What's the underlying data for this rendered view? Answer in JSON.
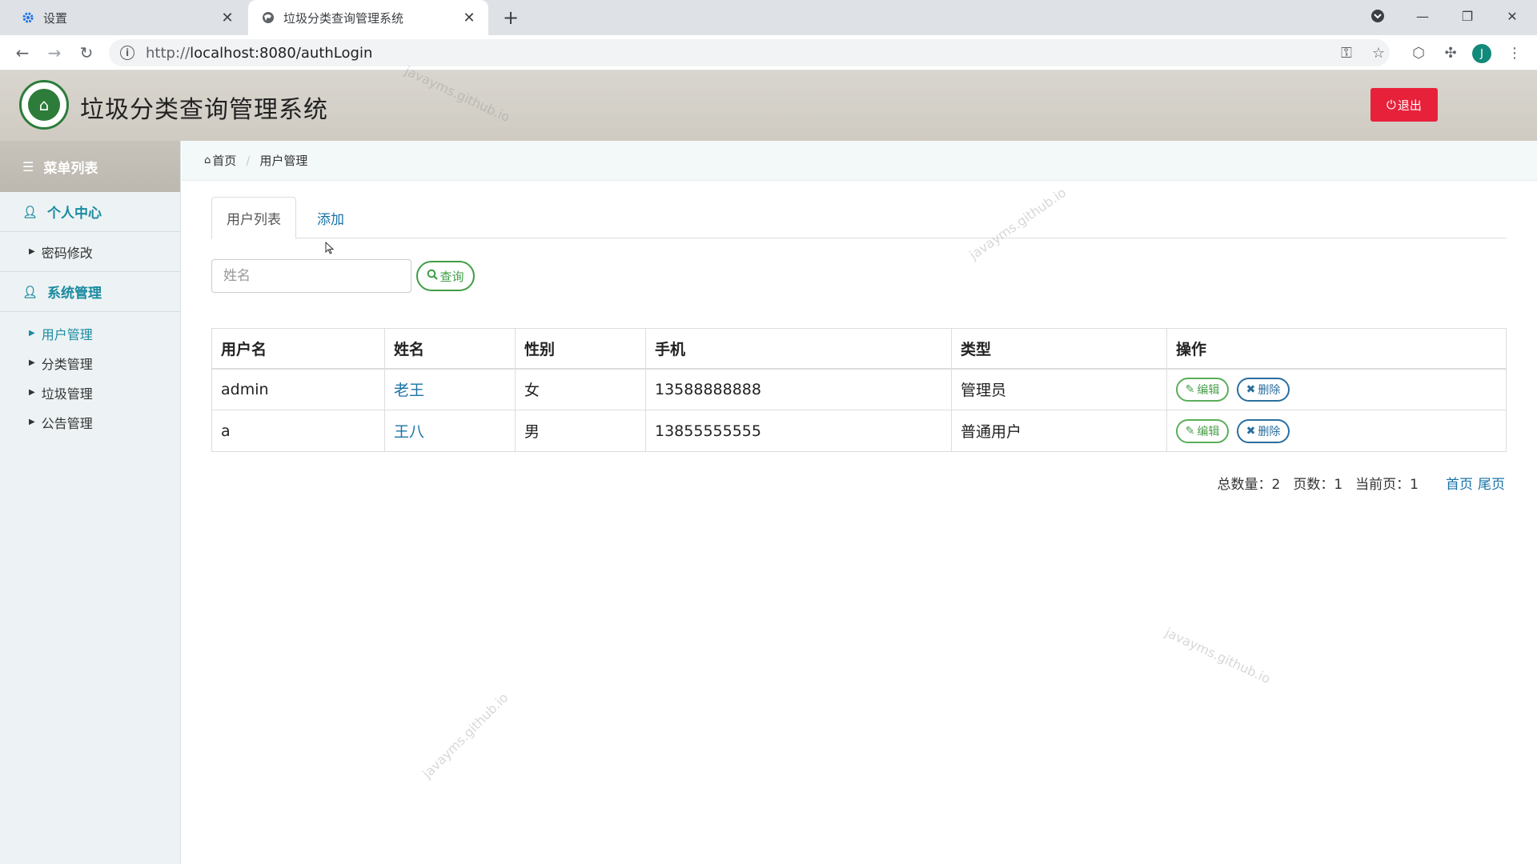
{
  "browser": {
    "tabs": [
      {
        "title": "设置",
        "icon": "gear-icon"
      },
      {
        "title": "垃圾分类查询管理系统",
        "icon": "globe-icon"
      }
    ],
    "url_proto": "http://",
    "url_rest": "localhost:8080/authLogin",
    "profile_initial": "J"
  },
  "header": {
    "title": "垃圾分类查询管理系统",
    "logout_label": "退出",
    "watermark": "javayms.github.io"
  },
  "sidebar": {
    "heading": "菜单列表",
    "sections": [
      {
        "label": "个人中心",
        "items": [
          {
            "label": "密码修改"
          }
        ]
      },
      {
        "label": "系统管理",
        "items": [
          {
            "label": "用户管理"
          },
          {
            "label": "分类管理"
          },
          {
            "label": "垃圾管理"
          },
          {
            "label": "公告管理"
          }
        ]
      }
    ]
  },
  "breadcrumb": {
    "home": "首页",
    "current": "用户管理"
  },
  "tabs": {
    "list": "用户列表",
    "add": "添加"
  },
  "search": {
    "placeholder": "姓名",
    "button": "查询"
  },
  "table": {
    "headers": [
      "用户名",
      "姓名",
      "性别",
      "手机",
      "类型",
      "操作"
    ],
    "rows": [
      {
        "username": "admin",
        "name": "老王",
        "gender": "女",
        "phone": "13588888888",
        "type": "管理员"
      },
      {
        "username": "a",
        "name": "王八",
        "gender": "男",
        "phone": "13855555555",
        "type": "普通用户"
      }
    ],
    "edit_label": "编辑",
    "delete_label": "删除"
  },
  "pager": {
    "total_label": "总数量：2",
    "pages_label": "页数：1",
    "current_label": "当前页：1",
    "first": "首页",
    "last": "尾页"
  },
  "colors": {
    "accent": "#1a8aa0",
    "danger": "#e8213b",
    "success": "#3e9d46",
    "link": "#1a73a8"
  }
}
